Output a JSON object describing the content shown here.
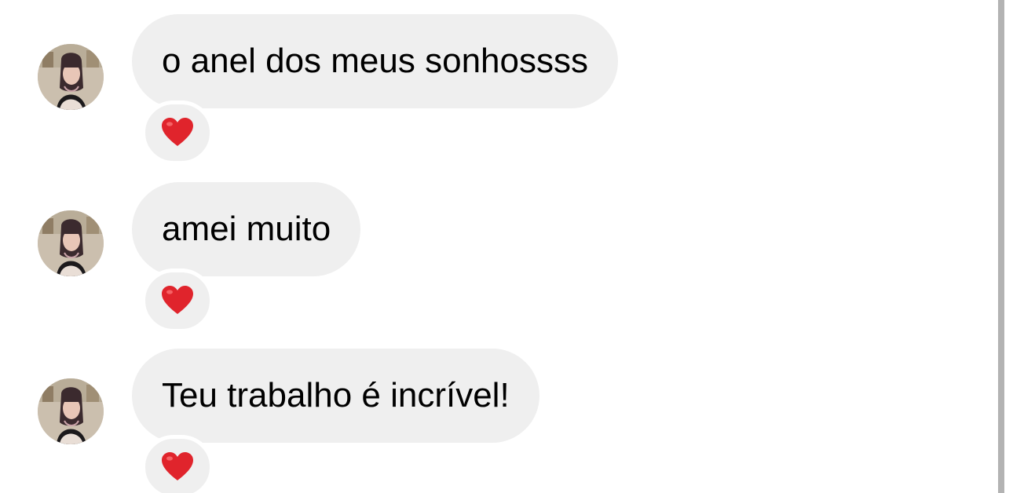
{
  "messages": [
    {
      "text": "o anel dos meus sonhossss",
      "reaction": "heart-emoji"
    },
    {
      "text": "amei muito",
      "reaction": "heart-emoji"
    },
    {
      "text": "Teu trabalho é incrível!",
      "reaction": "heart-emoji"
    }
  ],
  "colors": {
    "bubble": "#efefef",
    "text": "#000000",
    "heart": "#e0242c",
    "scrollbar": "#b3b3b3",
    "background": "#ffffff"
  }
}
